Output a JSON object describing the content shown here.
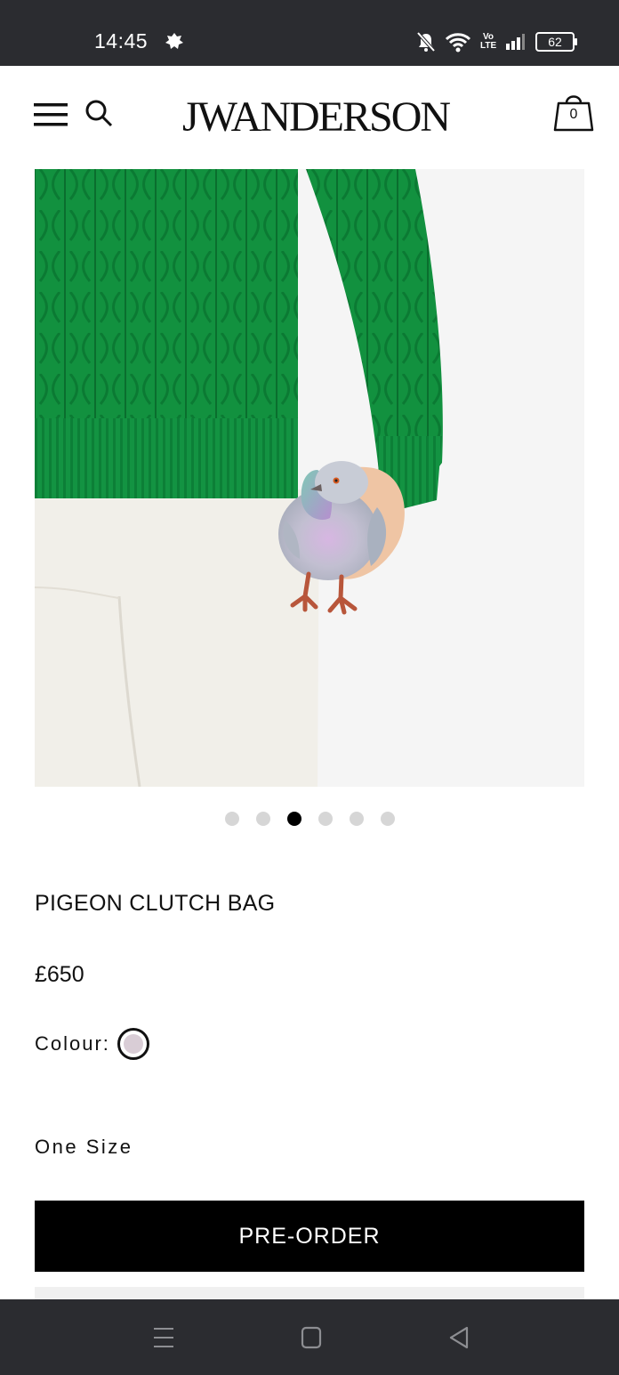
{
  "status_bar": {
    "time": "14:45",
    "battery": "62",
    "network_label": "Vo LTE",
    "icons": [
      "notification-icon",
      "mute-icon",
      "wifi-icon",
      "signal-icon",
      "battery-icon"
    ]
  },
  "header": {
    "logo": "JWANDERSON",
    "cart_count": "0",
    "icons": [
      "menu-icon",
      "search-icon",
      "shopping-bag-icon"
    ]
  },
  "product": {
    "name": "PIGEON CLUTCH BAG",
    "price": "£650",
    "colour_label": "Colour:",
    "colour_swatch": "#d9cdd6",
    "size": "One Size",
    "cta_label": "PRE-ORDER",
    "image_count": 6,
    "active_image_index": 2
  },
  "colors": {
    "status_bar_bg": "#2b2c30",
    "button_bg": "#000000",
    "sweater_green": "#12913f"
  },
  "nav_bar": {
    "icons": [
      "recent-apps-icon",
      "home-icon",
      "back-icon"
    ]
  }
}
